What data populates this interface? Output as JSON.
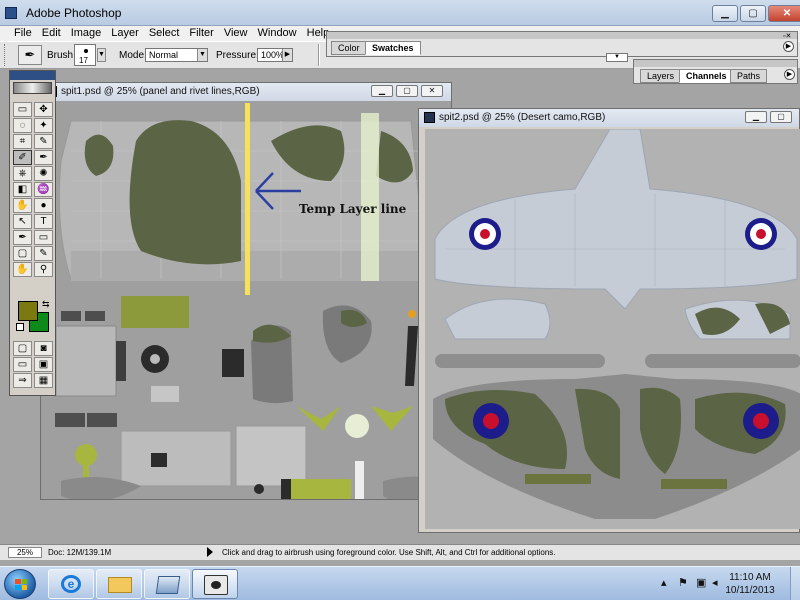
{
  "app": {
    "title": "Adobe Photoshop"
  },
  "menu": [
    "File",
    "Edit",
    "Image",
    "Layer",
    "Select",
    "Filter",
    "View",
    "Window",
    "Help"
  ],
  "options_bar": {
    "brush_label": "Brush:",
    "brush_size": "17",
    "mode_label": "Mode:",
    "mode_value": "Normal",
    "pressure_label": "Pressure:",
    "pressure_value": "100%"
  },
  "palettes": {
    "top": {
      "tabs": [
        "Color",
        "Swatches"
      ],
      "active": "Swatches"
    },
    "layers": {
      "tabs": [
        "Layers",
        "Channels",
        "Paths"
      ],
      "active": "Channels"
    }
  },
  "doc1": {
    "title": "spit1.psd @ 25% (panel and rivet lines,RGB)",
    "annotation": "Temp Layer line"
  },
  "doc2": {
    "title": "spit2.psd @ 25% (Desert camo,RGB)"
  },
  "tools": [
    "▭",
    "✥",
    "◌",
    "✦",
    "⌗",
    "✎",
    "✐",
    "✒",
    "⎈",
    "✺",
    "◧",
    "♒",
    "✋",
    "●",
    "↖",
    "T",
    "✒",
    "▭",
    "▢",
    "✎",
    "✋",
    "⚲"
  ],
  "colors": {
    "foreground": "#7a7a10",
    "background": "#0e8a1a",
    "camo_green": "#5b6445",
    "roundel_blue": "#1c1c8a",
    "roundel_red": "#c8102e"
  },
  "status": {
    "zoom": "25%",
    "doc": "Doc: 12M/139.1M",
    "message": "Click and drag to airbrush using foreground color.  Use Shift, Alt, and Ctrl for additional options."
  },
  "taskbar": {
    "time": "11:10 AM",
    "date": "10/11/2013"
  }
}
